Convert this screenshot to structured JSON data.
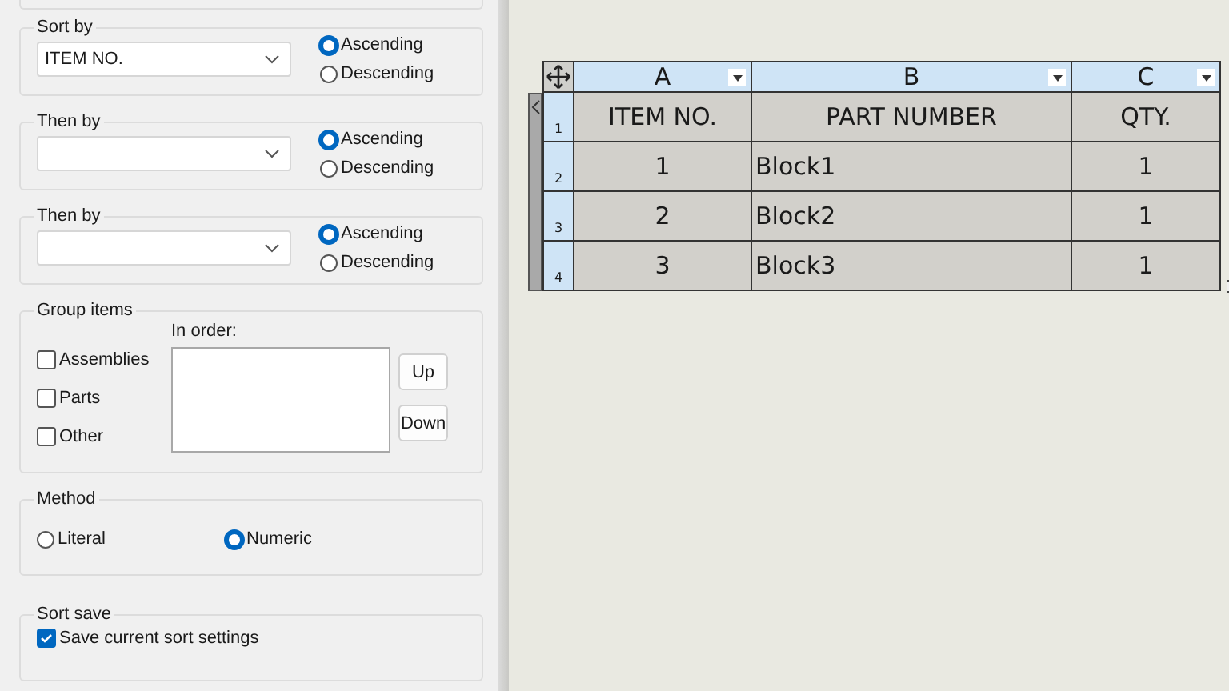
{
  "sort_groups": [
    {
      "title": "Sort by",
      "field_value": "ITEM NO.",
      "options": [
        {
          "label": "Ascending",
          "selected": true
        },
        {
          "label": "Descending",
          "selected": false
        }
      ]
    },
    {
      "title": "Then by",
      "options": [
        {
          "label": "Ascending",
          "selected": true
        },
        {
          "label": "Descending",
          "selected": false
        }
      ]
    },
    {
      "title": "Then by",
      "options": [
        {
          "label": "Ascending",
          "selected": true
        },
        {
          "label": "Descending",
          "selected": false
        }
      ]
    }
  ],
  "group_items": {
    "title": "Group items",
    "checkboxes": [
      {
        "label": "Assemblies",
        "checked": false
      },
      {
        "label": "Parts",
        "checked": false
      },
      {
        "label": "Other",
        "checked": false
      }
    ],
    "order_label": "In order:",
    "buttons": [
      "Up",
      "Down"
    ]
  },
  "method": {
    "title": "Method",
    "options": [
      {
        "label": "Literal",
        "selected": false
      },
      {
        "label": "Numeric",
        "selected": true
      }
    ]
  },
  "sort_save": {
    "title": "Sort save",
    "checkbox": {
      "label": "Save current sort settings",
      "checked": true
    }
  },
  "table": {
    "columns": [
      "A",
      "B",
      "C"
    ],
    "rows": [
      {
        "number": "1",
        "kind": "header",
        "cells": [
          "ITEM NO.",
          "PART NUMBER",
          "QTY."
        ]
      },
      {
        "number": "2",
        "kind": "data",
        "cells": [
          "1",
          "Block1",
          "1"
        ]
      },
      {
        "number": "3",
        "kind": "data",
        "cells": [
          "2",
          "Block2",
          "1"
        ]
      },
      {
        "number": "4",
        "kind": "data",
        "cells": [
          "3",
          "Block3",
          "1"
        ]
      }
    ]
  }
}
